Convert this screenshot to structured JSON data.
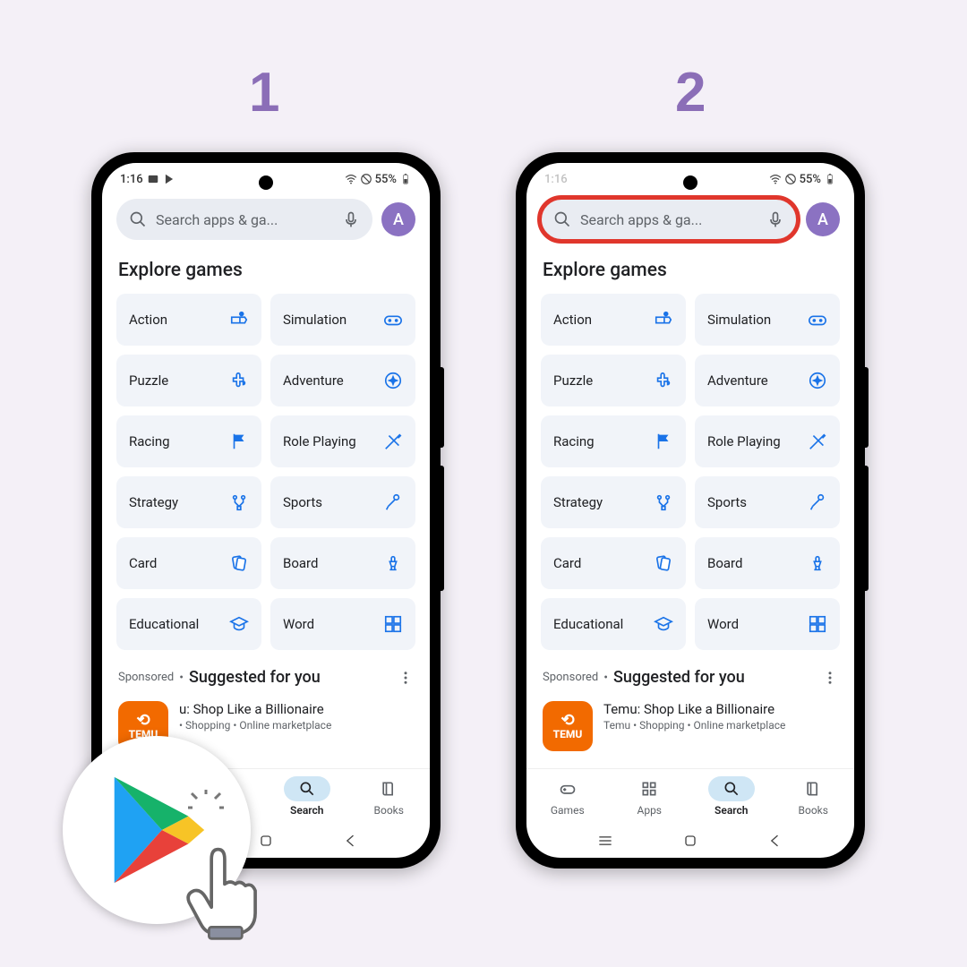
{
  "steps": [
    "1",
    "2"
  ],
  "status": {
    "time": "1:16",
    "battery": "55%"
  },
  "search": {
    "placeholder": "Search apps & ga..."
  },
  "avatar": "A",
  "section_title": "Explore games",
  "categories": [
    {
      "label": "Action"
    },
    {
      "label": "Simulation"
    },
    {
      "label": "Puzzle"
    },
    {
      "label": "Adventure"
    },
    {
      "label": "Racing"
    },
    {
      "label": "Role Playing"
    },
    {
      "label": "Strategy"
    },
    {
      "label": "Sports"
    },
    {
      "label": "Card"
    },
    {
      "label": "Board"
    },
    {
      "label": "Educational"
    },
    {
      "label": "Word"
    }
  ],
  "sponsored": {
    "label": "Sponsored",
    "title": "Suggested for you",
    "app": {
      "icon_text": "TEMU",
      "title": "Temu: Shop Like a Billionaire",
      "subtitle1": "Temu",
      "subtitle2": "Shopping",
      "subtitle3": "Online marketplace",
      "cut_title": "u: Shop Like a Billionaire"
    }
  },
  "nav": {
    "games": "Games",
    "apps": "Apps",
    "search": "Search",
    "books": "Books"
  }
}
